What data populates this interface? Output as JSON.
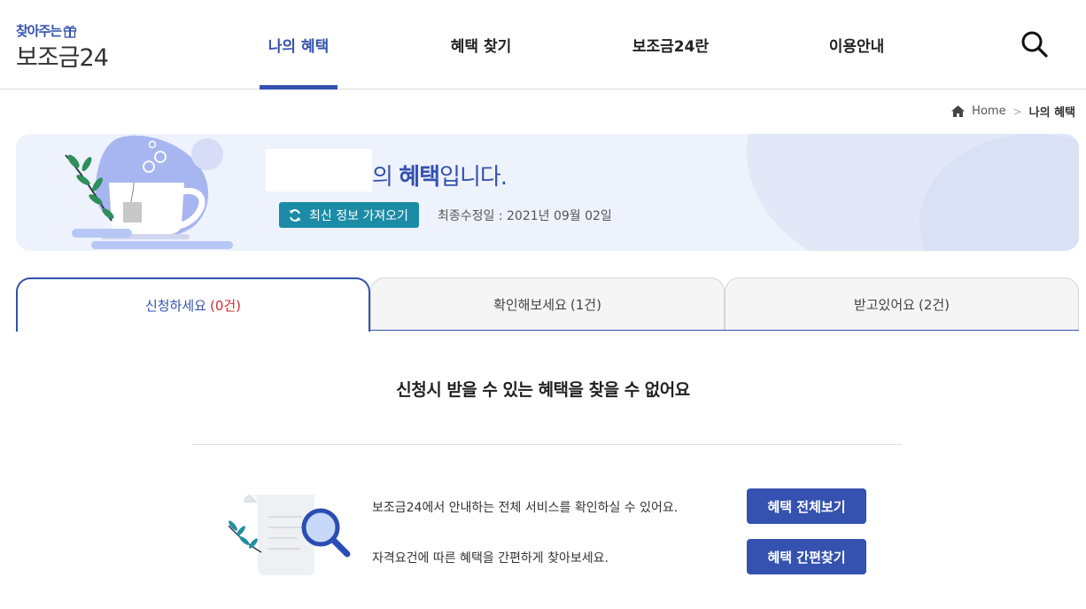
{
  "logo": {
    "top": "찾아주는",
    "bottom": "보조금24"
  },
  "nav": [
    {
      "label": "나의 혜택",
      "active": true
    },
    {
      "label": "혜택 찾기",
      "active": false
    },
    {
      "label": "보조금24란",
      "active": false
    },
    {
      "label": "이용안내",
      "active": false
    }
  ],
  "breadcrumb": {
    "home": "Home",
    "current": "나의 혜택"
  },
  "banner": {
    "title_prefix": "의 ",
    "title_bold": "혜택",
    "title_suffix": "입니다.",
    "refresh_label": "최신 정보 가져오기",
    "modified": "최종수정일 : 2021년 09월 02일"
  },
  "tabs": [
    {
      "label": "신청하세요",
      "count": "(0건)",
      "active": true
    },
    {
      "label": "확인해보세요",
      "count": "(1건)",
      "active": false
    },
    {
      "label": "받고있어요",
      "count": "(2건)",
      "active": false
    }
  ],
  "empty_message": "신청시 받을 수 있는 혜택을 찾을 수 없어요",
  "guides": [
    {
      "text": "보조금24에서 안내하는 전체 서비스를 확인하실 수 있어요.",
      "button": "혜택 전체보기"
    },
    {
      "text": "자격요건에 따른 혜택을 간편하게 찾아보세요.",
      "button": "혜택 간편찾기"
    }
  ],
  "colors": {
    "primary": "#3552b0",
    "teal": "#1b8ba6",
    "red": "#d12b2b"
  }
}
